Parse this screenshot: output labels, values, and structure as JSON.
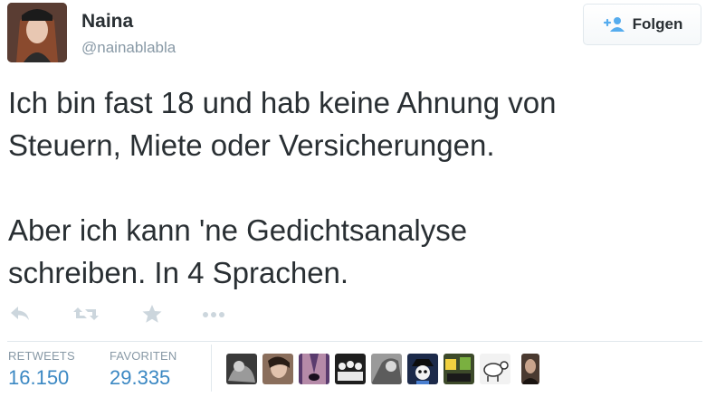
{
  "user": {
    "name": "Naina",
    "handle": "@nainablabla",
    "avatar_bg": "#6b4a3a"
  },
  "follow_button": {
    "label": "Folgen",
    "icon": "add-user-icon",
    "icon_color": "#55acee"
  },
  "tweet": {
    "text": "Ich bin fast 18 und hab keine Ahnung von\nSteuern, Miete oder Versicherungen.\n\nAber ich kann 'ne Gedichtsanalyse\nschreiben. In 4 Sprachen."
  },
  "actions": [
    {
      "name": "reply",
      "icon": "reply-icon"
    },
    {
      "name": "retweet",
      "icon": "retweet-icon"
    },
    {
      "name": "favorite",
      "icon": "star-icon"
    },
    {
      "name": "more",
      "icon": "more-icon"
    }
  ],
  "stats": {
    "retweets_label": "RETWEETS",
    "retweets_value": "16.150",
    "favorites_label": "FAVORITEN",
    "favorites_value": "29.335"
  },
  "colors": {
    "text": "#292f33",
    "muted": "#8899a6",
    "stat_value": "#3b88c3",
    "action_icon": "#ccd6dd",
    "border": "#e1e8ed"
  },
  "favoriter_avatars": [
    {
      "bg": "#3a3a3a"
    },
    {
      "bg": "#8a6e5c"
    },
    {
      "bg": "#5a3b6e"
    },
    {
      "bg": "#1e1e1e"
    },
    {
      "bg": "#9a9a9a"
    },
    {
      "bg": "#1c2a4a"
    },
    {
      "bg": "#3d4a2a"
    },
    {
      "bg": "#f2f2f2"
    },
    {
      "bg": "#4a3a30"
    }
  ]
}
